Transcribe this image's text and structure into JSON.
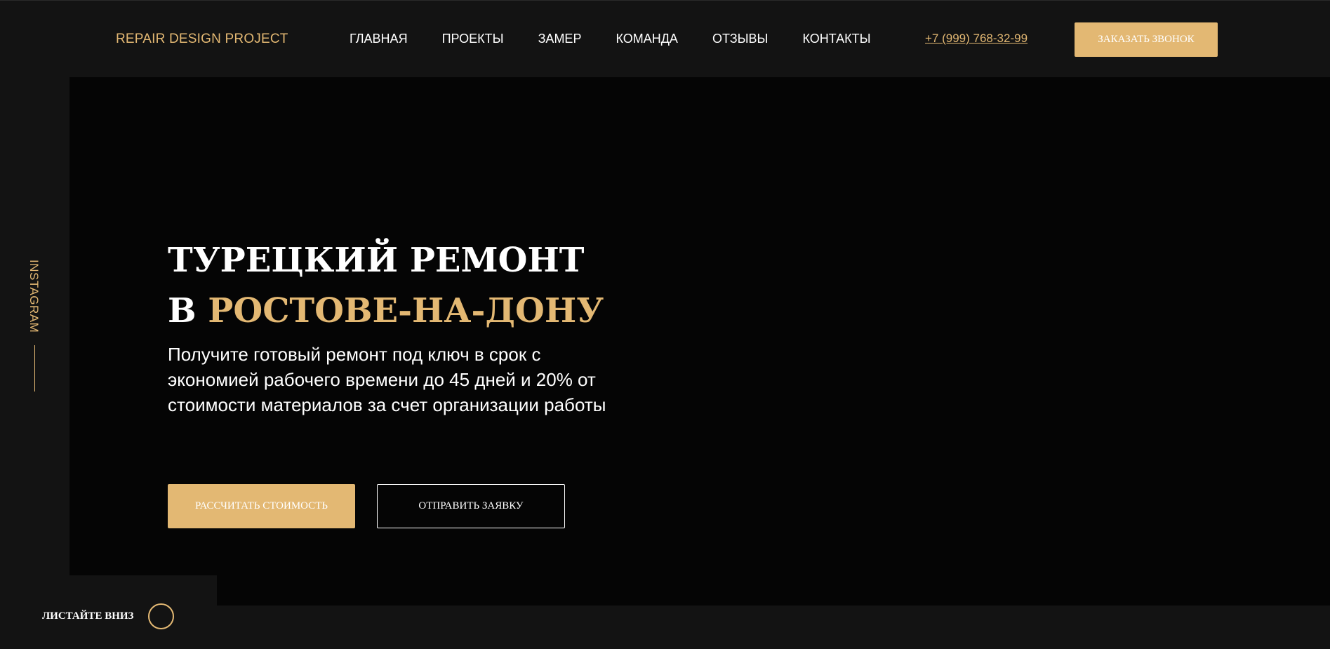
{
  "header": {
    "logo": "REPAIR DESIGN PROJECT",
    "nav": [
      "ГЛАВНАЯ",
      "ПРОЕКТЫ",
      "ЗАМЕР",
      "КОМАНДА",
      "ОТЗЫВЫ",
      "КОНТАКТЫ"
    ],
    "phone": "+7 (999) 768-32-99",
    "call_button": "ЗАКАЗАТЬ ЗВОНОК"
  },
  "hero": {
    "title_line1": "ТУРЕЦКИЙ РЕМОНТ",
    "title_line2_prefix": "В ",
    "title_line2_accent": "РОСТОВЕ-НА-ДОНУ",
    "description": "Получите готовый ремонт под ключ в срок с экономией рабочего времени до 45 дней и 20% от стоимости материалов за счет организации работы",
    "btn_calculate": "РАССЧИТАТЬ СТОИМОСТЬ",
    "btn_send": "ОТПРАВИТЬ ЗАЯВКУ"
  },
  "social": {
    "label": "INSTAGRAM"
  },
  "scroll": {
    "label": "ЛИСТАЙТЕ ВНИЗ"
  },
  "colors": {
    "accent": "#e3b873",
    "background": "#131313",
    "hero_background": "#050505"
  }
}
